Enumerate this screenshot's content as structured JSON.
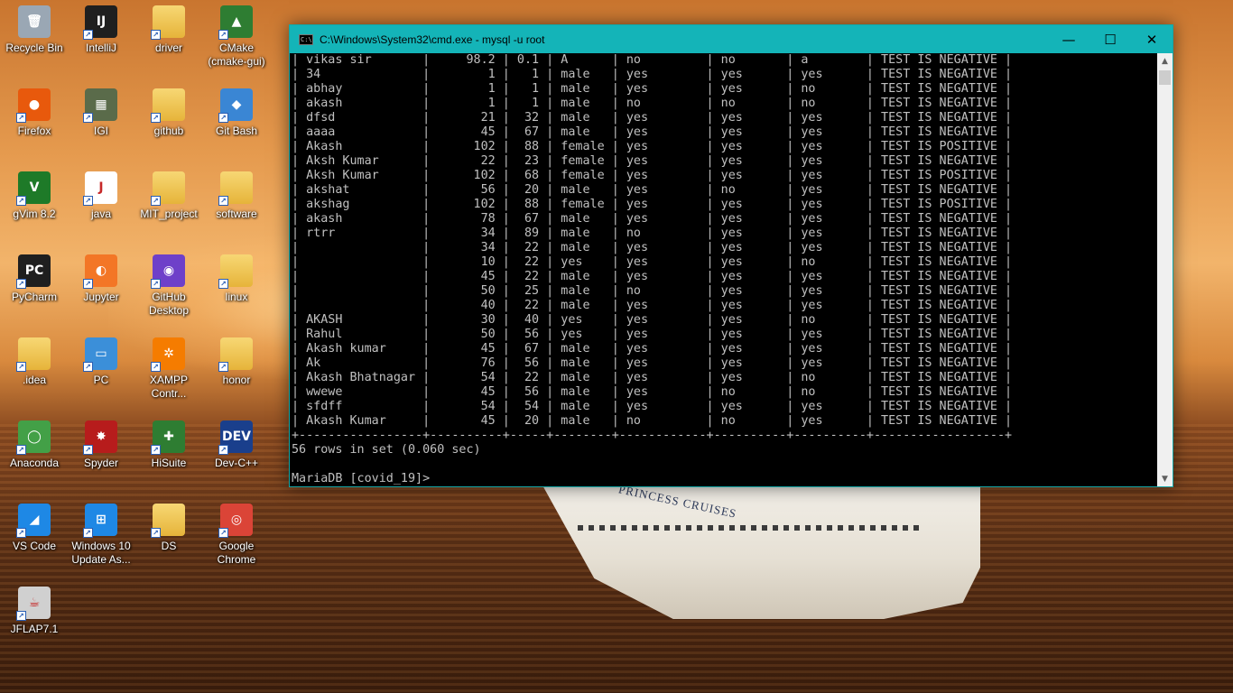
{
  "window": {
    "title": "C:\\Windows\\System32\\cmd.exe - mysql  -u root",
    "minimize": "—",
    "maximize": "☐",
    "close": "✕"
  },
  "console": {
    "rows": [
      [
        "vikas sir",
        "98.2",
        "0.1",
        "A",
        "no",
        "no",
        "a",
        "TEST IS NEGATIVE"
      ],
      [
        "34",
        "1",
        "1",
        "male",
        "yes",
        "yes",
        "yes",
        "TEST IS NEGATIVE"
      ],
      [
        "abhay",
        "1",
        "1",
        "male",
        "yes",
        "yes",
        "no",
        "TEST IS NEGATIVE"
      ],
      [
        "akash",
        "1",
        "1",
        "male",
        "no",
        "no",
        "no",
        "TEST IS NEGATIVE"
      ],
      [
        "dfsd",
        "21",
        "32",
        "male",
        "yes",
        "yes",
        "yes",
        "TEST IS NEGATIVE"
      ],
      [
        "aaaa",
        "45",
        "67",
        "male",
        "yes",
        "yes",
        "yes",
        "TEST IS NEGATIVE"
      ],
      [
        "Akash",
        "102",
        "88",
        "female",
        "yes",
        "yes",
        "yes",
        "TEST IS POSITIVE"
      ],
      [
        "Aksh Kumar",
        "22",
        "23",
        "female",
        "yes",
        "yes",
        "yes",
        "TEST IS NEGATIVE"
      ],
      [
        "Aksh Kumar",
        "102",
        "68",
        "female",
        "yes",
        "yes",
        "yes",
        "TEST IS POSITIVE"
      ],
      [
        "akshat",
        "56",
        "20",
        "male",
        "yes",
        "no",
        "yes",
        "TEST IS NEGATIVE"
      ],
      [
        "akshag",
        "102",
        "88",
        "female",
        "yes",
        "yes",
        "yes",
        "TEST IS POSITIVE"
      ],
      [
        "akash",
        "78",
        "67",
        "male",
        "yes",
        "yes",
        "yes",
        "TEST IS NEGATIVE"
      ],
      [
        "rtrr",
        "34",
        "89",
        "male",
        "no",
        "yes",
        "yes",
        "TEST IS NEGATIVE"
      ],
      [
        "",
        "34",
        "22",
        "male",
        "yes",
        "yes",
        "yes",
        "TEST IS NEGATIVE"
      ],
      [
        "",
        "10",
        "22",
        "yes",
        "yes",
        "yes",
        "no",
        "TEST IS NEGATIVE"
      ],
      [
        "",
        "45",
        "22",
        "male",
        "yes",
        "yes",
        "yes",
        "TEST IS NEGATIVE"
      ],
      [
        "",
        "50",
        "25",
        "male",
        "no",
        "yes",
        "yes",
        "TEST IS NEGATIVE"
      ],
      [
        "",
        "40",
        "22",
        "male",
        "yes",
        "yes",
        "yes",
        "TEST IS NEGATIVE"
      ],
      [
        "AKASH",
        "30",
        "40",
        "yes",
        "yes",
        "yes",
        "no",
        "TEST IS NEGATIVE"
      ],
      [
        "Rahul",
        "50",
        "56",
        "yes",
        "yes",
        "yes",
        "yes",
        "TEST IS NEGATIVE"
      ],
      [
        "Akash kumar",
        "45",
        "67",
        "male",
        "yes",
        "yes",
        "yes",
        "TEST IS NEGATIVE"
      ],
      [
        "Ak",
        "76",
        "56",
        "male",
        "yes",
        "yes",
        "yes",
        "TEST IS NEGATIVE"
      ],
      [
        "Akash Bhatnagar",
        "54",
        "22",
        "male",
        "yes",
        "yes",
        "no",
        "TEST IS NEGATIVE"
      ],
      [
        "wwewe",
        "45",
        "56",
        "male",
        "yes",
        "no",
        "no",
        "TEST IS NEGATIVE"
      ],
      [
        "sfdff",
        "54",
        "54",
        "male",
        "yes",
        "yes",
        "yes",
        "TEST IS NEGATIVE"
      ],
      [
        "Akash Kumar",
        "45",
        "20",
        "male",
        "no",
        "no",
        "yes",
        "TEST IS NEGATIVE"
      ]
    ],
    "summary": "56 rows in set (0.060 sec)",
    "prompt": "MariaDB [covid_19]> "
  },
  "desktop": {
    "icons": [
      {
        "label": "Recycle Bin",
        "glyph": "🗑",
        "color": "#9aa7b4",
        "icon": "recycle-bin-icon"
      },
      {
        "label": "IntelliJ",
        "glyph": "IJ",
        "color": "#1f1f1f",
        "icon": "intellij-icon"
      },
      {
        "label": "driver",
        "glyph": "",
        "color": "#e6b43a",
        "icon": "folder-icon"
      },
      {
        "label": "CMake (cmake-gui)",
        "glyph": "▲",
        "color": "#2e7d32",
        "icon": "cmake-icon"
      },
      {
        "label": "Firefox",
        "glyph": "●",
        "color": "#e8590c",
        "icon": "firefox-icon"
      },
      {
        "label": "IGI",
        "glyph": "▦",
        "color": "#5a6b4a",
        "icon": "igi-icon"
      },
      {
        "label": "github",
        "glyph": "",
        "color": "#e6b43a",
        "icon": "folder-icon"
      },
      {
        "label": "Git Bash",
        "glyph": "◆",
        "color": "#3a86d4",
        "icon": "git-bash-icon"
      },
      {
        "label": "gVim 8.2",
        "glyph": "V",
        "color": "#1e7a28",
        "icon": "gvim-icon"
      },
      {
        "label": "java",
        "glyph": "J",
        "color": "#ffffff",
        "icon": "java-icon"
      },
      {
        "label": "MIT_project",
        "glyph": "",
        "color": "#e6b43a",
        "icon": "folder-icon"
      },
      {
        "label": "software",
        "glyph": "",
        "color": "#e6b43a",
        "icon": "folder-icon"
      },
      {
        "label": "PyCharm",
        "glyph": "PC",
        "color": "#1f1f1f",
        "icon": "pycharm-icon"
      },
      {
        "label": "Jupyter",
        "glyph": "◐",
        "color": "#f37626",
        "icon": "jupyter-icon"
      },
      {
        "label": "GitHub Desktop",
        "glyph": "◉",
        "color": "#6e40c9",
        "icon": "github-desktop-icon"
      },
      {
        "label": "linux",
        "glyph": "",
        "color": "#e6b43a",
        "icon": "folder-icon"
      },
      {
        "label": ".idea",
        "glyph": "",
        "color": "#e6b43a",
        "icon": "folder-icon"
      },
      {
        "label": "PC",
        "glyph": "▭",
        "color": "#3b8fd9",
        "icon": "pc-icon"
      },
      {
        "label": "XAMPP Contr...",
        "glyph": "✲",
        "color": "#f57c00",
        "icon": "xampp-icon"
      },
      {
        "label": "honor",
        "glyph": "",
        "color": "#e6b43a",
        "icon": "folder-icon"
      },
      {
        "label": "Anaconda",
        "glyph": "◯",
        "color": "#43a047",
        "icon": "anaconda-icon"
      },
      {
        "label": "Spyder",
        "glyph": "✸",
        "color": "#b71c1c",
        "icon": "spyder-icon"
      },
      {
        "label": "HiSuite",
        "glyph": "✚",
        "color": "#2e7d32",
        "icon": "hisuite-icon"
      },
      {
        "label": "Dev-C++",
        "glyph": "DEV",
        "color": "#1a3f8c",
        "icon": "devcpp-icon"
      },
      {
        "label": "VS Code",
        "glyph": "◢",
        "color": "#1e88e5",
        "icon": "vscode-icon"
      },
      {
        "label": "Windows 10 Update As...",
        "glyph": "⊞",
        "color": "#1e88e5",
        "icon": "windows-update-icon"
      },
      {
        "label": "DS",
        "glyph": "",
        "color": "#e6b43a",
        "icon": "folder-icon"
      },
      {
        "label": "Google Chrome",
        "glyph": "◎",
        "color": "#db4437",
        "icon": "chrome-icon"
      },
      {
        "label": "JFLAP7.1",
        "glyph": "☕",
        "color": "#d0d0d0",
        "icon": "jflap-icon"
      }
    ]
  },
  "wallpaper": {
    "ship_text": "PRINCESS CRUISES"
  }
}
